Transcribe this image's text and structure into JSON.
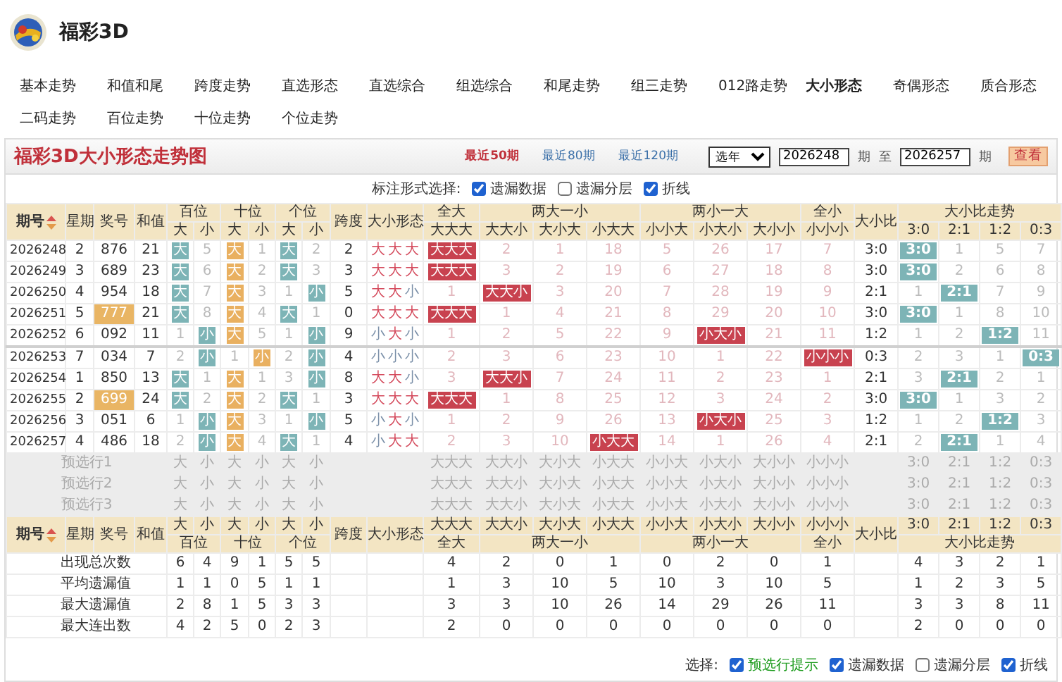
{
  "site": {
    "title": "福彩3D"
  },
  "nav": [
    {
      "label": "基本走势",
      "selected": false
    },
    {
      "label": "和值和尾",
      "selected": false
    },
    {
      "label": "跨度走势",
      "selected": false
    },
    {
      "label": "直选形态",
      "selected": false
    },
    {
      "label": "直选综合",
      "selected": false
    },
    {
      "label": "组选综合",
      "selected": false
    },
    {
      "label": "和尾走势",
      "selected": false
    },
    {
      "label": "组三走势",
      "selected": false
    },
    {
      "label": "012路走势",
      "selected": false
    },
    {
      "label": "大小形态",
      "selected": true
    },
    {
      "label": "奇偶形态",
      "selected": false
    },
    {
      "label": "质合形态",
      "selected": false
    },
    {
      "label": "二码走势",
      "selected": false
    },
    {
      "label": "百位走势",
      "selected": false
    },
    {
      "label": "十位走势",
      "selected": false
    },
    {
      "label": "个位走势",
      "selected": false
    }
  ],
  "panel": {
    "title": "福彩3D大小形态走势图",
    "ranges": [
      {
        "label": "最近50期",
        "selected": true
      },
      {
        "label": "最近80期",
        "selected": false
      },
      {
        "label": "最近120期",
        "selected": false
      }
    ],
    "year_select": "选年",
    "from": "2026248",
    "from_unit": "期",
    "to_word": "至",
    "to": "2026257",
    "to_unit": "期",
    "button": "查看"
  },
  "mark_options": {
    "label": "标注形式选择:",
    "options": [
      {
        "label": "遗漏数据",
        "checked": true
      },
      {
        "label": "遗漏分层",
        "checked": false
      },
      {
        "label": "折线",
        "checked": true
      }
    ]
  },
  "table": {
    "header": {
      "issue": "期号",
      "weekday": "星期",
      "number": "奖号",
      "sum": "和值",
      "positions": [
        {
          "name": "百位",
          "sub": [
            "大",
            "小"
          ]
        },
        {
          "name": "十位",
          "sub": [
            "大",
            "小"
          ]
        },
        {
          "name": "个位",
          "sub": [
            "大",
            "小"
          ]
        }
      ],
      "span": "跨度",
      "shape": "大小形态",
      "form_groups": [
        {
          "name": "全大",
          "forms": [
            "大大大"
          ]
        },
        {
          "name": "两大一小",
          "forms": [
            "大大小",
            "大小大",
            "小大大"
          ]
        },
        {
          "name": "两小一大",
          "forms": [
            "小小大",
            "小大小",
            "大小小"
          ]
        },
        {
          "name": "全小",
          "forms": [
            "小小小"
          ]
        }
      ],
      "ratio": "大小比",
      "trend": {
        "name": "大小比走势",
        "ratios": [
          "3:0",
          "2:1",
          "1:2",
          "0:3"
        ]
      }
    },
    "rows": [
      {
        "issue": "2026248",
        "weekday": "2",
        "number": "876",
        "highlighted": false,
        "sum": "21",
        "cells": [
          {
            "t": "大",
            "hit": true
          },
          {
            "t": "5",
            "hit": false
          },
          {
            "t": "大",
            "hit": true
          },
          {
            "t": "1",
            "hit": false
          },
          {
            "t": "大",
            "hit": true
          },
          {
            "t": "2",
            "hit": false
          }
        ],
        "span": "2",
        "shape": [
          {
            "t": "大",
            "big": true
          },
          {
            "t": "大",
            "big": true
          },
          {
            "t": "大",
            "big": true
          }
        ],
        "forms": [
          {
            "t": "大大大",
            "hit": true
          },
          {
            "t": "2",
            "hit": false
          },
          {
            "t": "1",
            "hit": false
          },
          {
            "t": "18",
            "hit": false
          },
          {
            "t": "5",
            "hit": false
          },
          {
            "t": "26",
            "hit": false
          },
          {
            "t": "17",
            "hit": false
          },
          {
            "t": "7",
            "hit": false
          }
        ],
        "ratio": "3:0",
        "trend": [
          {
            "t": "3:0",
            "hit": true
          },
          {
            "t": "1",
            "hit": false
          },
          {
            "t": "5",
            "hit": false
          },
          {
            "t": "7",
            "hit": false
          }
        ]
      },
      {
        "issue": "2026249",
        "weekday": "3",
        "number": "689",
        "highlighted": false,
        "sum": "23",
        "cells": [
          {
            "t": "大",
            "hit": true
          },
          {
            "t": "6",
            "hit": false
          },
          {
            "t": "大",
            "hit": true
          },
          {
            "t": "2",
            "hit": false
          },
          {
            "t": "大",
            "hit": true
          },
          {
            "t": "3",
            "hit": false
          }
        ],
        "span": "3",
        "shape": [
          {
            "t": "大",
            "big": true
          },
          {
            "t": "大",
            "big": true
          },
          {
            "t": "大",
            "big": true
          }
        ],
        "forms": [
          {
            "t": "大大大",
            "hit": true
          },
          {
            "t": "3",
            "hit": false
          },
          {
            "t": "2",
            "hit": false
          },
          {
            "t": "19",
            "hit": false
          },
          {
            "t": "6",
            "hit": false
          },
          {
            "t": "27",
            "hit": false
          },
          {
            "t": "18",
            "hit": false
          },
          {
            "t": "8",
            "hit": false
          }
        ],
        "ratio": "3:0",
        "trend": [
          {
            "t": "3:0",
            "hit": true
          },
          {
            "t": "2",
            "hit": false
          },
          {
            "t": "6",
            "hit": false
          },
          {
            "t": "8",
            "hit": false
          }
        ]
      },
      {
        "issue": "2026250",
        "weekday": "4",
        "number": "954",
        "highlighted": false,
        "sum": "18",
        "cells": [
          {
            "t": "大",
            "hit": true
          },
          {
            "t": "7",
            "hit": false
          },
          {
            "t": "大",
            "hit": true
          },
          {
            "t": "3",
            "hit": false
          },
          {
            "t": "1",
            "hit": false
          },
          {
            "t": "小",
            "hit": true
          }
        ],
        "span": "5",
        "shape": [
          {
            "t": "大",
            "big": true
          },
          {
            "t": "大",
            "big": true
          },
          {
            "t": "小",
            "big": false
          }
        ],
        "forms": [
          {
            "t": "1",
            "hit": false
          },
          {
            "t": "大大小",
            "hit": true
          },
          {
            "t": "3",
            "hit": false
          },
          {
            "t": "20",
            "hit": false
          },
          {
            "t": "7",
            "hit": false
          },
          {
            "t": "28",
            "hit": false
          },
          {
            "t": "19",
            "hit": false
          },
          {
            "t": "9",
            "hit": false
          }
        ],
        "ratio": "2:1",
        "trend": [
          {
            "t": "1",
            "hit": false
          },
          {
            "t": "2:1",
            "hit": true
          },
          {
            "t": "7",
            "hit": false
          },
          {
            "t": "9",
            "hit": false
          }
        ]
      },
      {
        "issue": "2026251",
        "weekday": "5",
        "number": "777",
        "highlighted": true,
        "sum": "21",
        "cells": [
          {
            "t": "大",
            "hit": true
          },
          {
            "t": "8",
            "hit": false
          },
          {
            "t": "大",
            "hit": true
          },
          {
            "t": "4",
            "hit": false
          },
          {
            "t": "大",
            "hit": true
          },
          {
            "t": "1",
            "hit": false
          }
        ],
        "span": "0",
        "shape": [
          {
            "t": "大",
            "big": true
          },
          {
            "t": "大",
            "big": true
          },
          {
            "t": "大",
            "big": true
          }
        ],
        "forms": [
          {
            "t": "大大大",
            "hit": true
          },
          {
            "t": "1",
            "hit": false
          },
          {
            "t": "4",
            "hit": false
          },
          {
            "t": "21",
            "hit": false
          },
          {
            "t": "8",
            "hit": false
          },
          {
            "t": "29",
            "hit": false
          },
          {
            "t": "20",
            "hit": false
          },
          {
            "t": "10",
            "hit": false
          }
        ],
        "ratio": "3:0",
        "trend": [
          {
            "t": "3:0",
            "hit": true
          },
          {
            "t": "1",
            "hit": false
          },
          {
            "t": "8",
            "hit": false
          },
          {
            "t": "10",
            "hit": false
          }
        ]
      },
      {
        "issue": "2026252",
        "weekday": "6",
        "number": "092",
        "highlighted": false,
        "sum": "11",
        "cells": [
          {
            "t": "1",
            "hit": false
          },
          {
            "t": "小",
            "hit": true
          },
          {
            "t": "大",
            "hit": true
          },
          {
            "t": "5",
            "hit": false
          },
          {
            "t": "1",
            "hit": false
          },
          {
            "t": "小",
            "hit": true
          }
        ],
        "span": "9",
        "shape": [
          {
            "t": "小",
            "big": false
          },
          {
            "t": "大",
            "big": true
          },
          {
            "t": "小",
            "big": false
          }
        ],
        "forms": [
          {
            "t": "1",
            "hit": false
          },
          {
            "t": "2",
            "hit": false
          },
          {
            "t": "5",
            "hit": false
          },
          {
            "t": "22",
            "hit": false
          },
          {
            "t": "9",
            "hit": false
          },
          {
            "t": "小大小",
            "hit": true
          },
          {
            "t": "21",
            "hit": false
          },
          {
            "t": "11",
            "hit": false
          }
        ],
        "ratio": "1:2",
        "trend": [
          {
            "t": "1",
            "hit": false
          },
          {
            "t": "2",
            "hit": false
          },
          {
            "t": "1:2",
            "hit": true
          },
          {
            "t": "11",
            "hit": false
          }
        ]
      },
      {
        "issue": "2026253",
        "weekday": "7",
        "number": "034",
        "highlighted": false,
        "sum": "7",
        "cells": [
          {
            "t": "2",
            "hit": false
          },
          {
            "t": "小",
            "hit": true
          },
          {
            "t": "1",
            "hit": false
          },
          {
            "t": "小",
            "hit": true
          },
          {
            "t": "2",
            "hit": false
          },
          {
            "t": "小",
            "hit": true
          }
        ],
        "span": "4",
        "shape": [
          {
            "t": "小",
            "big": false
          },
          {
            "t": "小",
            "big": false
          },
          {
            "t": "小",
            "big": false
          }
        ],
        "forms": [
          {
            "t": "2",
            "hit": false
          },
          {
            "t": "3",
            "hit": false
          },
          {
            "t": "6",
            "hit": false
          },
          {
            "t": "23",
            "hit": false
          },
          {
            "t": "10",
            "hit": false
          },
          {
            "t": "1",
            "hit": false
          },
          {
            "t": "22",
            "hit": false
          },
          {
            "t": "小小小",
            "hit": true
          }
        ],
        "ratio": "0:3",
        "trend": [
          {
            "t": "2",
            "hit": false
          },
          {
            "t": "3",
            "hit": false
          },
          {
            "t": "1",
            "hit": false
          },
          {
            "t": "0:3",
            "hit": true
          }
        ]
      },
      {
        "issue": "2026254",
        "weekday": "1",
        "number": "850",
        "highlighted": false,
        "sum": "13",
        "cells": [
          {
            "t": "大",
            "hit": true
          },
          {
            "t": "1",
            "hit": false
          },
          {
            "t": "大",
            "hit": true
          },
          {
            "t": "1",
            "hit": false
          },
          {
            "t": "3",
            "hit": false
          },
          {
            "t": "小",
            "hit": true
          }
        ],
        "span": "8",
        "shape": [
          {
            "t": "大",
            "big": true
          },
          {
            "t": "大",
            "big": true
          },
          {
            "t": "小",
            "big": false
          }
        ],
        "forms": [
          {
            "t": "3",
            "hit": false
          },
          {
            "t": "大大小",
            "hit": true
          },
          {
            "t": "7",
            "hit": false
          },
          {
            "t": "24",
            "hit": false
          },
          {
            "t": "11",
            "hit": false
          },
          {
            "t": "2",
            "hit": false
          },
          {
            "t": "23",
            "hit": false
          },
          {
            "t": "1",
            "hit": false
          }
        ],
        "ratio": "2:1",
        "trend": [
          {
            "t": "3",
            "hit": false
          },
          {
            "t": "2:1",
            "hit": true
          },
          {
            "t": "2",
            "hit": false
          },
          {
            "t": "1",
            "hit": false
          }
        ]
      },
      {
        "issue": "2026255",
        "weekday": "2",
        "number": "699",
        "highlighted": true,
        "sum": "24",
        "cells": [
          {
            "t": "大",
            "hit": true
          },
          {
            "t": "2",
            "hit": false
          },
          {
            "t": "大",
            "hit": true
          },
          {
            "t": "2",
            "hit": false
          },
          {
            "t": "大",
            "hit": true
          },
          {
            "t": "1",
            "hit": false
          }
        ],
        "span": "3",
        "shape": [
          {
            "t": "大",
            "big": true
          },
          {
            "t": "大",
            "big": true
          },
          {
            "t": "大",
            "big": true
          }
        ],
        "forms": [
          {
            "t": "大大大",
            "hit": true
          },
          {
            "t": "1",
            "hit": false
          },
          {
            "t": "8",
            "hit": false
          },
          {
            "t": "25",
            "hit": false
          },
          {
            "t": "12",
            "hit": false
          },
          {
            "t": "3",
            "hit": false
          },
          {
            "t": "24",
            "hit": false
          },
          {
            "t": "2",
            "hit": false
          }
        ],
        "ratio": "3:0",
        "trend": [
          {
            "t": "3:0",
            "hit": true
          },
          {
            "t": "1",
            "hit": false
          },
          {
            "t": "3",
            "hit": false
          },
          {
            "t": "2",
            "hit": false
          }
        ]
      },
      {
        "issue": "2026256",
        "weekday": "3",
        "number": "051",
        "highlighted": false,
        "sum": "6",
        "cells": [
          {
            "t": "1",
            "hit": false
          },
          {
            "t": "小",
            "hit": true
          },
          {
            "t": "大",
            "hit": true
          },
          {
            "t": "3",
            "hit": false
          },
          {
            "t": "1",
            "hit": false
          },
          {
            "t": "小",
            "hit": true
          }
        ],
        "span": "5",
        "shape": [
          {
            "t": "小",
            "big": false
          },
          {
            "t": "大",
            "big": true
          },
          {
            "t": "小",
            "big": false
          }
        ],
        "forms": [
          {
            "t": "1",
            "hit": false
          },
          {
            "t": "2",
            "hit": false
          },
          {
            "t": "9",
            "hit": false
          },
          {
            "t": "26",
            "hit": false
          },
          {
            "t": "13",
            "hit": false
          },
          {
            "t": "小大小",
            "hit": true
          },
          {
            "t": "25",
            "hit": false
          },
          {
            "t": "3",
            "hit": false
          }
        ],
        "ratio": "1:2",
        "trend": [
          {
            "t": "1",
            "hit": false
          },
          {
            "t": "2",
            "hit": false
          },
          {
            "t": "1:2",
            "hit": true
          },
          {
            "t": "3",
            "hit": false
          }
        ]
      },
      {
        "issue": "2026257",
        "weekday": "4",
        "number": "486",
        "highlighted": false,
        "sum": "18",
        "cells": [
          {
            "t": "2",
            "hit": false
          },
          {
            "t": "小",
            "hit": true
          },
          {
            "t": "大",
            "hit": true
          },
          {
            "t": "4",
            "hit": false
          },
          {
            "t": "大",
            "hit": true
          },
          {
            "t": "1",
            "hit": false
          }
        ],
        "span": "4",
        "shape": [
          {
            "t": "小",
            "big": false
          },
          {
            "t": "大",
            "big": true
          },
          {
            "t": "大",
            "big": true
          }
        ],
        "forms": [
          {
            "t": "2",
            "hit": false
          },
          {
            "t": "3",
            "hit": false
          },
          {
            "t": "10",
            "hit": false
          },
          {
            "t": "小大大",
            "hit": true
          },
          {
            "t": "14",
            "hit": false
          },
          {
            "t": "1",
            "hit": false
          },
          {
            "t": "26",
            "hit": false
          },
          {
            "t": "4",
            "hit": false
          }
        ],
        "ratio": "2:1",
        "trend": [
          {
            "t": "2",
            "hit": false
          },
          {
            "t": "2:1",
            "hit": true
          },
          {
            "t": "1",
            "hit": false
          },
          {
            "t": "4",
            "hit": false
          }
        ]
      }
    ],
    "preselect_rows": [
      {
        "label": "预选行1",
        "positions": [
          "大",
          "小",
          "大",
          "小",
          "大",
          "小"
        ],
        "forms": [
          "大大大",
          "大大小",
          "大小大",
          "小大大",
          "小小大",
          "小大小",
          "大小小",
          "小小小"
        ],
        "ratios": [
          "3:0",
          "2:1",
          "1:2",
          "0:3"
        ]
      },
      {
        "label": "预选行2",
        "positions": [
          "大",
          "小",
          "大",
          "小",
          "大",
          "小"
        ],
        "forms": [
          "大大大",
          "大大小",
          "大小大",
          "小大大",
          "小小大",
          "小大小",
          "大小小",
          "小小小"
        ],
        "ratios": [
          "3:0",
          "2:1",
          "1:2",
          "0:3"
        ]
      },
      {
        "label": "预选行3",
        "positions": [
          "大",
          "小",
          "大",
          "小",
          "大",
          "小"
        ],
        "forms": [
          "大大大",
          "大大小",
          "大小大",
          "小大大",
          "小小大",
          "小大小",
          "大小小",
          "小小小"
        ],
        "ratios": [
          "3:0",
          "2:1",
          "1:2",
          "0:3"
        ]
      }
    ],
    "footer_header": {
      "issue": "期号",
      "weekday": "星期",
      "number": "奖号",
      "sum": "和值",
      "positions": [
        {
          "name": "百位",
          "sub": [
            "大",
            "小"
          ]
        },
        {
          "name": "十位",
          "sub": [
            "大",
            "小"
          ]
        },
        {
          "name": "个位",
          "sub": [
            "大",
            "小"
          ]
        }
      ],
      "span": "跨度",
      "shape": "大小形态",
      "form_groups": [
        {
          "name": "全大",
          "forms": [
            "大大大"
          ]
        },
        {
          "name": "两大一小",
          "forms": [
            "大大小",
            "大小大",
            "小大大"
          ]
        },
        {
          "name": "两小一大",
          "forms": [
            "小小大",
            "小大小",
            "大小小"
          ]
        },
        {
          "name": "全小",
          "forms": [
            "小小小"
          ]
        }
      ],
      "ratio": "大小比",
      "trend": {
        "name": "大小比走势",
        "ratios": [
          "3:0",
          "2:1",
          "1:2",
          "0:3"
        ]
      }
    },
    "stats": [
      {
        "label": "出现总次数",
        "positions": [
          "6",
          "4",
          "9",
          "1",
          "5",
          "5"
        ],
        "forms": [
          "4",
          "2",
          "0",
          "1",
          "0",
          "2",
          "0",
          "1"
        ],
        "ratios": [
          "4",
          "3",
          "2",
          "1"
        ]
      },
      {
        "label": "平均遗漏值",
        "positions": [
          "1",
          "1",
          "0",
          "5",
          "1",
          "1"
        ],
        "forms": [
          "1",
          "3",
          "10",
          "5",
          "10",
          "3",
          "10",
          "5"
        ],
        "ratios": [
          "1",
          "2",
          "3",
          "5"
        ]
      },
      {
        "label": "最大遗漏值",
        "positions": [
          "2",
          "8",
          "1",
          "5",
          "3",
          "3"
        ],
        "forms": [
          "3",
          "3",
          "10",
          "26",
          "14",
          "29",
          "26",
          "11"
        ],
        "ratios": [
          "3",
          "3",
          "8",
          "11"
        ]
      },
      {
        "label": "最大连出数",
        "positions": [
          "4",
          "2",
          "5",
          "0",
          "2",
          "3"
        ],
        "forms": [
          "2",
          "0",
          "0",
          "0",
          "0",
          "0",
          "0",
          "0"
        ],
        "ratios": [
          "2",
          "0",
          "0",
          "0"
        ]
      }
    ]
  },
  "bottom_options": {
    "label": "选择:",
    "options": [
      {
        "label": "预选行提示",
        "checked": true,
        "kind": "hint"
      },
      {
        "label": "遗漏数据",
        "checked": true,
        "kind": "plain"
      },
      {
        "label": "遗漏分层",
        "checked": false,
        "kind": "plain"
      },
      {
        "label": "折线",
        "checked": true,
        "kind": "plain"
      }
    ]
  }
}
